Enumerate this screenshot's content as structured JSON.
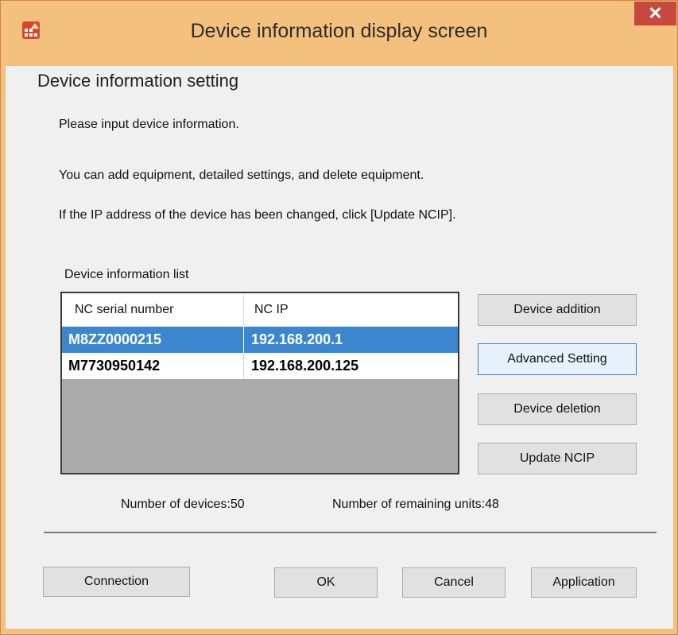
{
  "window": {
    "title": "Device information display screen",
    "close_glyph": "✕"
  },
  "heading": "Device information setting",
  "messages": {
    "line1": "Please input device information.",
    "line2": "You can add equipment, detailed settings, and delete equipment.",
    "line3": "If the IP address of the device has been changed, click [Update NCIP]."
  },
  "device_list": {
    "caption": "Device information list",
    "columns": [
      "NC serial number",
      "NC IP"
    ],
    "rows": [
      {
        "serial": "M8ZZ0000215",
        "ip": "192.168.200.1",
        "selected": true
      },
      {
        "serial": "M7730950142",
        "ip": "192.168.200.125",
        "selected": false
      }
    ]
  },
  "side_buttons": {
    "add": "Device addition",
    "advanced": "Advanced Setting",
    "delete": "Device deletion",
    "update": "Update NCIP"
  },
  "counts": {
    "devices": "Number of devices:50",
    "remaining": "Number of remaining units:48"
  },
  "footer_buttons": {
    "connection": "Connection",
    "ok": "OK",
    "cancel": "Cancel",
    "application": "Application"
  },
  "colors": {
    "titlebar": "#f4c07e",
    "close_button": "#c7483f",
    "selection": "#3b87cf",
    "list_background": "#ababab"
  },
  "icons": {
    "app": "app-grid-icon",
    "close": "close-icon"
  }
}
